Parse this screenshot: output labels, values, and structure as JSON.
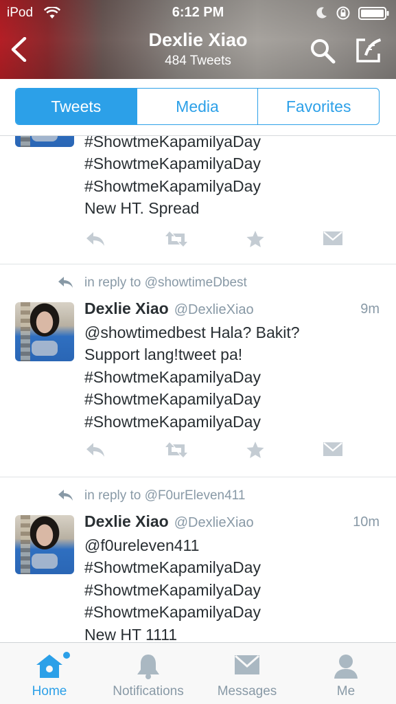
{
  "status_bar": {
    "carrier": "iPod",
    "time": "6:12 PM"
  },
  "header": {
    "name": "Dexlie Xiao",
    "tweet_count": "484 Tweets"
  },
  "tabs": [
    {
      "label": "Tweets",
      "active": true
    },
    {
      "label": "Media",
      "active": false
    },
    {
      "label": "Favorites",
      "active": false
    }
  ],
  "tweets": [
    {
      "text": "#ShowtmeKapamilyaDay\n#ShowtmeKapamilyaDay\n#ShowtmeKapamilyaDay\nNew HT.  Spread"
    },
    {
      "reply_to": "in reply to @showtimeDbest",
      "name": "Dexlie Xiao",
      "handle": "@DexlieXiao",
      "time": "9m",
      "text": "@showtimedbest Hala? Bakit?\nSupport lang!tweet pa!\n#ShowtmeKapamilyaDay\n#ShowtmeKapamilyaDay\n#ShowtmeKapamilyaDay"
    },
    {
      "reply_to": "in reply to @F0urEleven411",
      "name": "Dexlie Xiao",
      "handle": "@DexlieXiao",
      "time": "10m",
      "text": "@f0ureleven411\n#ShowtmeKapamilyaDay\n#ShowtmeKapamilyaDay\n#ShowtmeKapamilyaDay\nNew HT 1111"
    }
  ],
  "tab_bar": [
    {
      "label": "Home",
      "icon": "home-icon",
      "active": true
    },
    {
      "label": "Notifications",
      "icon": "bell-icon",
      "active": false
    },
    {
      "label": "Messages",
      "icon": "envelope-icon",
      "active": false
    },
    {
      "label": "Me",
      "icon": "person-icon",
      "active": false
    }
  ],
  "colors": {
    "accent": "#2ca0e8",
    "muted": "#8899a6",
    "text": "#292f33"
  }
}
